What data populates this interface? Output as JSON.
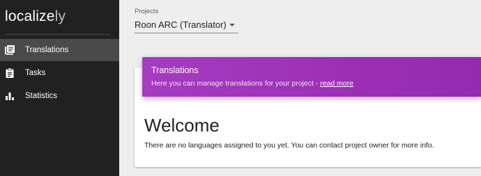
{
  "sidebar": {
    "logo": {
      "strong": "localize",
      "light": "ly"
    },
    "items": [
      {
        "label": "Translations",
        "icon": "translations-icon",
        "active": true
      },
      {
        "label": "Tasks",
        "icon": "clipboard-icon",
        "active": false
      },
      {
        "label": "Statistics",
        "icon": "bar-chart-icon",
        "active": false
      }
    ]
  },
  "header": {
    "projects_label": "Projects",
    "selected_project": "Roon ARC (Translator)"
  },
  "banner": {
    "title": "Translations",
    "text": "Here you can manage translations for your project - ",
    "link_text": "read more",
    "color": "#9c2fb5"
  },
  "welcome": {
    "title": "Welcome",
    "text": "There are no languages assigned to you yet. You can contact project owner for more info."
  },
  "colors": {
    "sidebar_bg": "#212121",
    "sidebar_active": "#4a4a4a",
    "page_bg": "#eeeeee",
    "accent": "#9c2fb5"
  }
}
